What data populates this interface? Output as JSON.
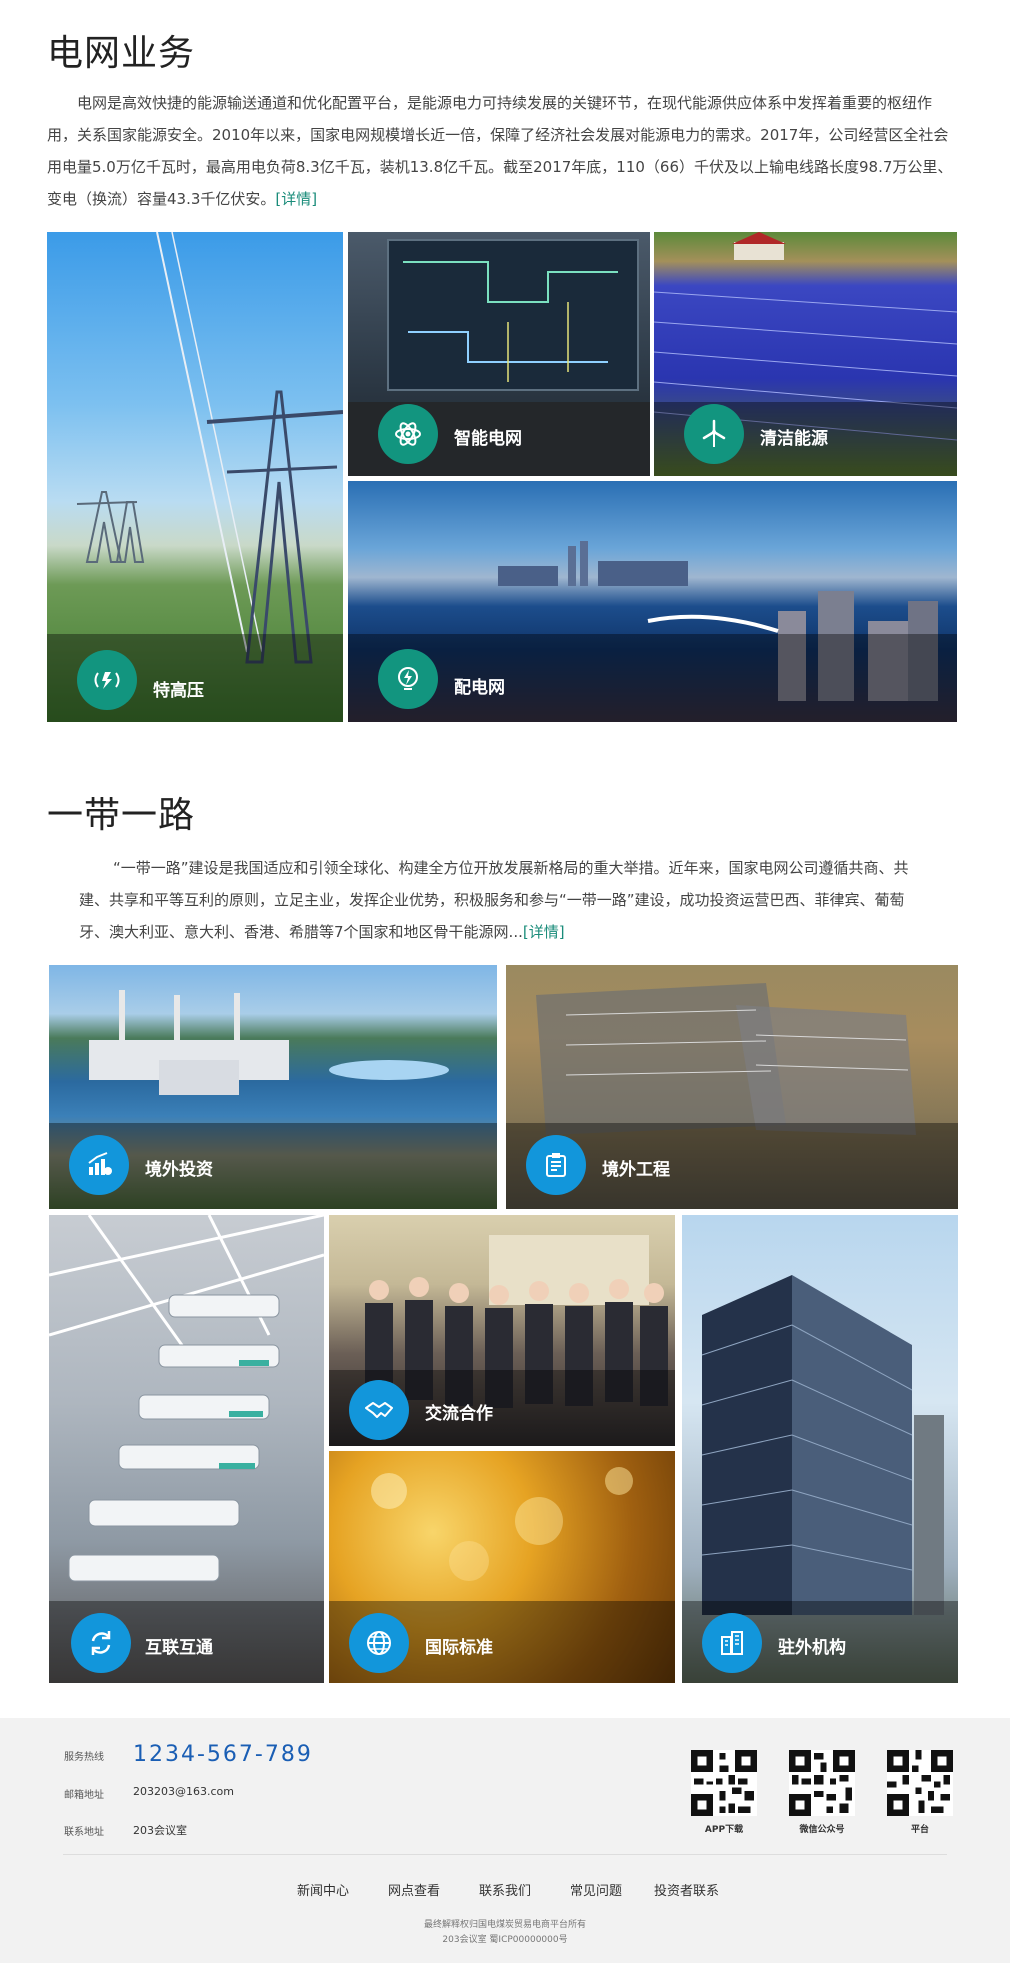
{
  "grid": {
    "title": "电网业务",
    "text": "电网是高效快捷的能源输送通道和优化配置平台，是能源电力可持续发展的关键环节，在现代能源供应体系中发挥着重要的枢纽作用，关系国家能源安全。2010年以来，国家电网规模增长近一倍，保障了经济社会发展对能源电力的需求。2017年，公司经营区全社会用电量5.0万亿千瓦时，最高用电负荷8.3亿千瓦，装机13.8亿千瓦。截至2017年底，110（66）千伏及以上输电线路长度98.7万公里、变电（换流）容量43.3千亿伏安。",
    "detail": "[详情]",
    "tiles": {
      "uhv": {
        "label": "特高压",
        "icon": "signal-waves-icon"
      },
      "smart": {
        "label": "智能电网",
        "icon": "atom-icon"
      },
      "clean": {
        "label": "清洁能源",
        "icon": "wind-turbine-icon"
      },
      "dist": {
        "label": "配电网",
        "icon": "lightning-bulb-icon"
      }
    }
  },
  "belt": {
    "title": "一带一路",
    "text": "“一带一路”建设是我国适应和引领全球化、构建全方位开放发展新格局的重大举措。近年来，国家电网公司遵循共商、共建、共享和平等互利的原则，立足主业，发挥企业优势，积极服务和参与“一带一路”建设，成功投资运营巴西、菲律宾、葡萄牙、澳大利亚、意大利、香港、希腊等7个国家和地区骨干能源网...",
    "detail": "[详情]",
    "tiles": {
      "invest": {
        "label": "境外投资",
        "icon": "chart-growth-icon"
      },
      "project": {
        "label": "境外工程",
        "icon": "blueprint-icon"
      },
      "exchange": {
        "label": "交流合作",
        "icon": "handshake-icon"
      },
      "interconnect": {
        "label": "互联互通",
        "icon": "sync-icon"
      },
      "standard": {
        "label": "国际标准",
        "icon": "globe-icon"
      },
      "office": {
        "label": "驻外机构",
        "icon": "buildings-icon"
      }
    }
  },
  "footer": {
    "hotline_label": "服务热线",
    "hotline": "1234-567-789",
    "email_label": "邮箱地址",
    "email": "203203@163.com",
    "address_label": "联系地址",
    "address": "203会议室",
    "qr": [
      "APP下载",
      "微信公众号",
      "平台"
    ],
    "nav": [
      "新闻中心",
      "网点查看",
      "联系我们",
      "常见问题",
      "投资者联系"
    ],
    "copyright_1": "最终解释权归国电煤炭贸易电商平台所有",
    "copyright_2": "203会议室 蜀ICP00000000号"
  }
}
